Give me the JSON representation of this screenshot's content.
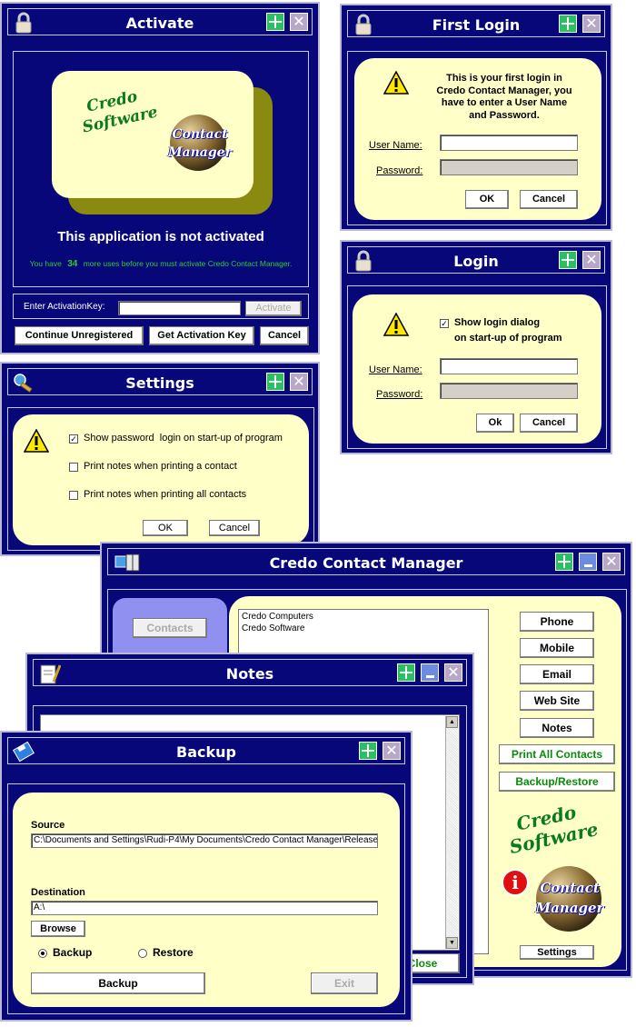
{
  "activate": {
    "title": "Activate",
    "not_activated": "This application is not activated",
    "uses_prefix": "You have",
    "uses_count": "34",
    "uses_suffix": "more uses before you must activate Credo Contact Manager.",
    "key_label": "Enter ActivationKey:",
    "key_value": "",
    "activate_button": "Activate",
    "continue_button": "Continue Unregistered",
    "get_key_button": "Get Activation Key",
    "cancel_button": "Cancel",
    "logo_line1": "Credo",
    "logo_line2": "Software",
    "globe_line1": "Contact",
    "globe_line2": "Manager"
  },
  "first_login": {
    "title": "First Login",
    "message": "This is your first login in Credo Contact Manager, you have to enter a User Name and Password.",
    "user_label": "User Name:",
    "password_label": "Password:",
    "ok_button": "OK",
    "cancel_button": "Cancel"
  },
  "login": {
    "title": "Login",
    "checkbox_label": "Show login dialog",
    "checkbox_label2": "on start-up of program",
    "user_label": "User Name:",
    "password_label": "Password:",
    "ok_button": "Ok",
    "cancel_button": "Cancel"
  },
  "settings": {
    "title": "Settings",
    "options": [
      {
        "label": "Show password  login on start-up of program",
        "checked": true
      },
      {
        "label": "Print notes when printing a contact",
        "checked": false
      },
      {
        "label": "Print notes when printing all contacts",
        "checked": false
      }
    ],
    "ok_button": "OK",
    "cancel_button": "Cancel"
  },
  "manager": {
    "title": "Credo Contact Manager",
    "contacts_tab": "Contacts",
    "contacts": [
      "Credo Computers",
      "Credo Software"
    ],
    "buttons": [
      "Phone",
      "Mobile",
      "Email",
      "Web Site",
      "Notes"
    ],
    "print_all_button": "Print All Contacts",
    "backup_restore_button": "Backup/Restore",
    "settings_button": "Settings",
    "logo_line1": "Credo",
    "logo_line2": "Software",
    "globe_line1": "Contact",
    "globe_line2": "Manager"
  },
  "notes": {
    "title": "Notes",
    "close_button": "Close"
  },
  "backup": {
    "title": "Backup",
    "source_label": "Source",
    "source_value": "C:\\Documents and Settings\\Rudi-P4\\My Documents\\Credo Contact Manager\\Release",
    "destination_label": "Destination",
    "destination_value": "A:\\",
    "browse_button": "Browse",
    "mode_backup": "Backup",
    "mode_restore": "Restore",
    "selected_mode": "Backup",
    "backup_button": "Backup",
    "exit_button": "Exit"
  },
  "colors": {
    "window_bg": "#07077a",
    "panel_bg": "#ffffc8",
    "logo_green": "#0a7a20",
    "maximize_green": "#28c060"
  }
}
